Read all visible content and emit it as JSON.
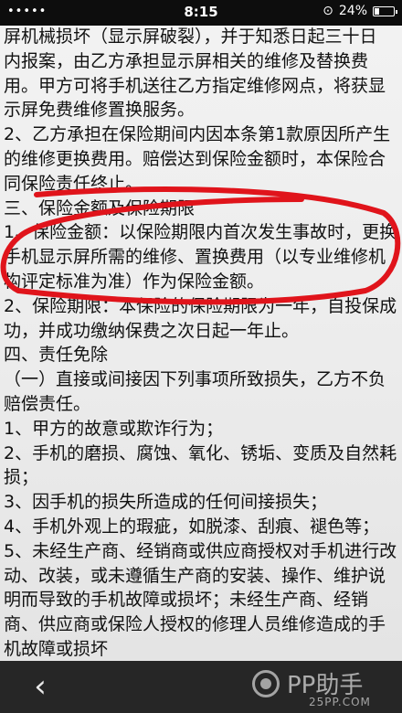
{
  "status_bar": {
    "signal": "•••••",
    "time": "8:15",
    "battery_percent": "24%",
    "battery_level": 0.24
  },
  "document": {
    "lines": [
      "屏机械损坏（显示屏破裂），并于知悉日起三十日",
      "内报案，由乙方承担显示屏相关的维修及替换费",
      "用。甲方可将手机送往乙方指定维修网点，将获显",
      "示屏免费维修置换服务。",
      "2、乙方承担在保险期间内因本条第1款原因所产生",
      "的维修更换费用。赔偿达到保险金额时，本保险合",
      "同保险责任终止。",
      "三、保险金额及保险期限",
      "1、保险金额：以保险期限内首次发生事故时，更换",
      "手机显示屏所需的维修、置换费用（以专业维修机",
      "构评定标准为准）作为保险金额。",
      "2、保险期限：本保险的保险期限为一年，自投保成",
      "功，并成功缴纳保费之次日起一年止。",
      "四、责任免除",
      "（一）直接或间接因下列事项所致损失，乙方不负",
      "赔偿责任。",
      "1、甲方的故意或欺诈行为；",
      "2、手机的磨损、腐蚀、氧化、锈垢、变质及自然耗",
      "损；",
      "3、因手机的损失所造成的任何间接损失；",
      "4、手机外观上的瑕疵，如脱漆、刮痕、褪色等；",
      "5、未经生产商、经销商或供应商授权对手机进行改",
      "动、改装，或未遵循生产商的安装、操作、维护说",
      "明而导致的手机故障或损坏；未经生产商、经销",
      "商、供应商或保险人授权的修理人员维修造成的手",
      "机故障或损坏"
    ],
    "annotation_color": "#e0141b"
  },
  "bottom_bar": {
    "back_glyph": "‹",
    "watermark_text": "PP助手",
    "watermark_url": "25PP.COM"
  }
}
